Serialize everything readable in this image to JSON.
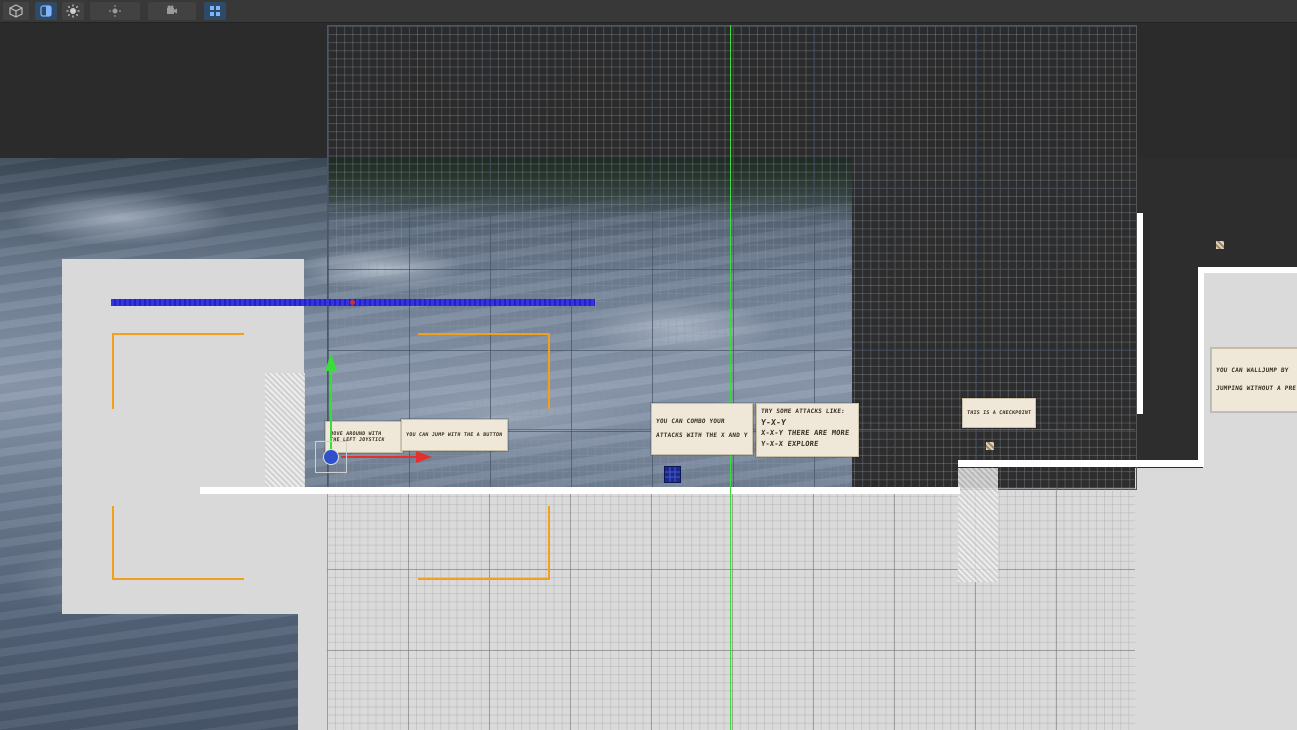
{
  "toolbar": {
    "buttons": [
      {
        "name": "cube-icon"
      },
      {
        "name": "shading-icon"
      },
      {
        "name": "sun-icon"
      },
      {
        "name": "lighting-icon"
      },
      {
        "name": "camera-icon"
      },
      {
        "name": "grid-icon"
      }
    ]
  },
  "signs": {
    "move": [
      "MOVE AROUND WITH",
      "THE LEFT JOYSTICK"
    ],
    "jump": [
      "YOU CAN JUMP WITH THE A BUTTON"
    ],
    "combo": [
      "YOU CAN COMBO YOUR",
      "ATTACKS WITH THE X AND Y"
    ],
    "attacks": [
      "TRY SOME ATTACKS LIKE:",
      "Y-X-Y",
      "X-X-Y  THERE ARE MORE",
      "Y-X-X    EXPLORE"
    ],
    "checkpoint": [
      "THIS IS A CHECKPOINT"
    ],
    "walljump": [
      "YOU CAN WALLJUMP BY",
      "JUMPING WITHOUT A PRE"
    ]
  },
  "colors": {
    "green_axis": "#3ddc3d",
    "red_axis": "#e53030",
    "blue_bar": "#2a2ad8",
    "orange_bounds": "#f2a01c",
    "navy_block": "#1a2a8c"
  }
}
